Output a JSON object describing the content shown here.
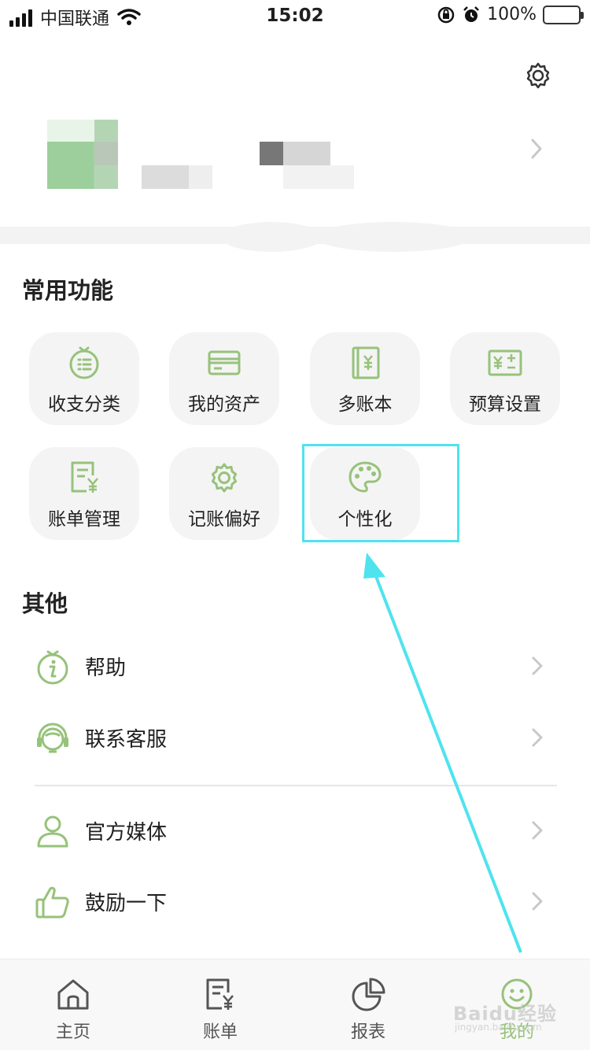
{
  "status_bar": {
    "carrier": "中国联通",
    "time": "15:02",
    "battery": "100%"
  },
  "sections": {
    "common_title": "常用功能",
    "other_title": "其他"
  },
  "features": [
    {
      "label": "收支分类",
      "icon": "category-icon"
    },
    {
      "label": "我的资产",
      "icon": "card-icon"
    },
    {
      "label": "多账本",
      "icon": "ledger-book-icon"
    },
    {
      "label": "预算设置",
      "icon": "budget-icon"
    },
    {
      "label": "账单管理",
      "icon": "bill-icon"
    },
    {
      "label": "记账偏好",
      "icon": "gear-icon"
    },
    {
      "label": "个性化",
      "icon": "palette-icon"
    }
  ],
  "other_items": [
    {
      "label": "帮助",
      "icon": "help-icon"
    },
    {
      "label": "联系客服",
      "icon": "headset-icon"
    },
    {
      "label": "官方媒体",
      "icon": "user-icon"
    },
    {
      "label": "鼓励一下",
      "icon": "thumbs-up-icon"
    }
  ],
  "tab_bar": [
    {
      "label": "主页",
      "icon": "home-icon"
    },
    {
      "label": "账单",
      "icon": "bill-icon"
    },
    {
      "label": "报表",
      "icon": "pie-chart-icon"
    },
    {
      "label": "我的",
      "icon": "smile-icon"
    }
  ],
  "watermark": {
    "text": "Baidu经验",
    "sub": "jingyan.baidu.com"
  },
  "colors": {
    "accent_green": "#96c27a",
    "highlight_cyan": "#4fe3ee",
    "tile_bg": "#f4f4f4"
  }
}
